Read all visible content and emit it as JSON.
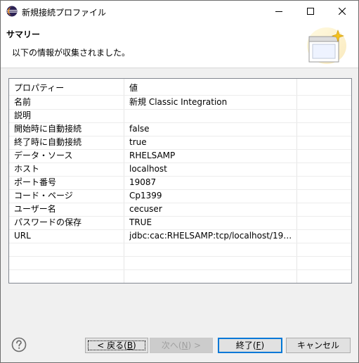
{
  "window": {
    "title": "新規接続プロファイル"
  },
  "banner": {
    "title": "サマリー",
    "description": "以下の情報が収集されました。"
  },
  "table": {
    "headers": {
      "property": "プロパティー",
      "value": "値"
    },
    "rows": [
      {
        "key": "名前",
        "value": "新規 Classic Integration"
      },
      {
        "key": "説明",
        "value": ""
      },
      {
        "key": "開始時に自動接続",
        "value": "false"
      },
      {
        "key": "終了時に自動接続",
        "value": "true"
      },
      {
        "key": "データ・ソース",
        "value": "RHELSAMP"
      },
      {
        "key": "ホスト",
        "value": "localhost"
      },
      {
        "key": "ポート番号",
        "value": "19087"
      },
      {
        "key": "コード・ページ",
        "value": "Cp1399"
      },
      {
        "key": "ユーザー名",
        "value": "cecuser"
      },
      {
        "key": "パスワードの保存",
        "value": "TRUE"
      },
      {
        "key": "URL",
        "value": "jdbc:cac:RHELSAMP:tcp/localhost/19087:..."
      },
      {
        "key": "",
        "value": ""
      },
      {
        "key": "",
        "value": ""
      },
      {
        "key": "",
        "value": ""
      }
    ]
  },
  "buttons": {
    "back": {
      "prefix": "< 戻る(",
      "mnemonic": "B",
      "suffix": ")"
    },
    "next": {
      "prefix": "次へ(",
      "mnemonic": "N",
      "suffix": ") >"
    },
    "finish": {
      "prefix": "終了(",
      "mnemonic": "F",
      "suffix": ")"
    },
    "cancel": "キャンセル"
  },
  "colors": {
    "accent": "#0078d7",
    "disabled_text": "#a0a0a0"
  },
  "icons": {
    "app": "eclipse-icon",
    "minimize": "minimize-icon",
    "maximize": "maximize-icon",
    "close": "close-icon",
    "banner": "wizard-banner-icon",
    "help": "help-icon"
  }
}
